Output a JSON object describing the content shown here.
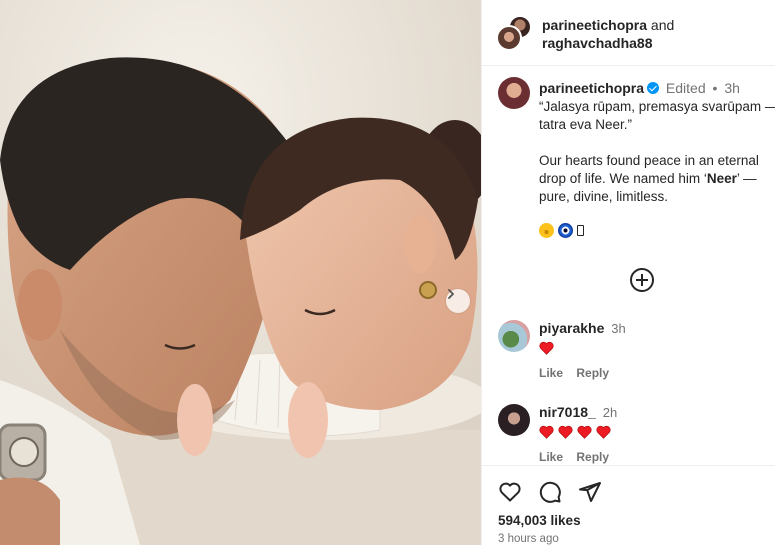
{
  "post": {
    "collab_user_1": "parineetichopra",
    "collab_and": "and",
    "collab_user_2": "raghavchadha88",
    "caption": {
      "username": "parineetichopra",
      "edited_label": "Edited",
      "separator": "•",
      "time": "3h",
      "line1": "“Jalasya rūpam, premasya svarūpam — tatra eva Neer.”",
      "line2_a": "Our hearts found peace in an eternal drop of life. We named him ‘",
      "line2_bold": "Neer",
      "line2_b": "’ — pure, divine, limitless."
    },
    "emojis": [
      "smiling-face-icon",
      "nazar-amulet-icon",
      "unknown-glyph-icon"
    ],
    "comments": [
      {
        "username": "piyarakhe",
        "time": "3h",
        "hearts": 1,
        "like_label": "Like",
        "reply_label": "Reply"
      },
      {
        "username": "nir7018_",
        "time": "2h",
        "hearts": 4,
        "like_label": "Like",
        "reply_label": "Reply"
      }
    ],
    "likes": "594,003 likes",
    "posted_ago": "3 hours ago"
  },
  "colors": {
    "verified": "#0095f6",
    "heart": "#ed1c24",
    "muted_text": "#737373"
  }
}
